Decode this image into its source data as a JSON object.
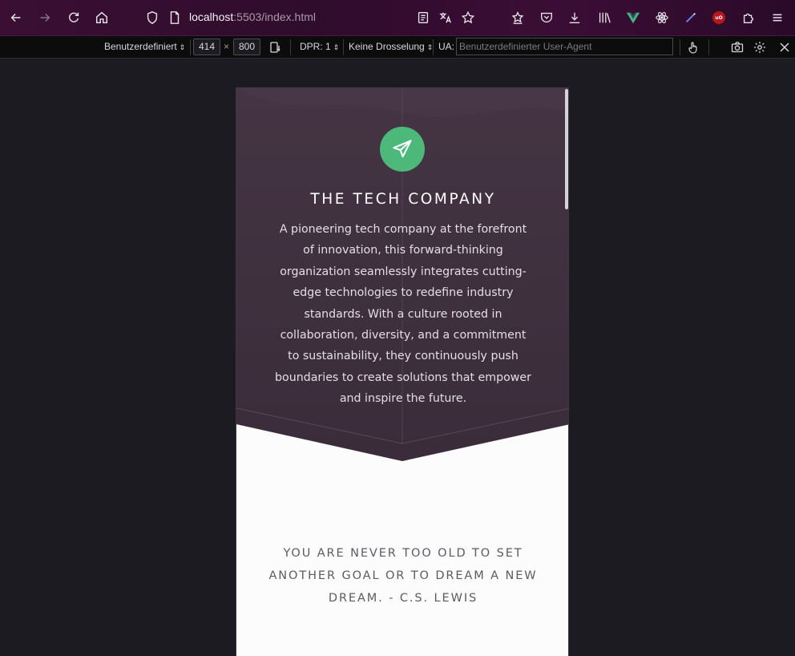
{
  "browser": {
    "url_host": "localhost",
    "url_rest": ":5503/index.html"
  },
  "rdm": {
    "device": "Benutzerdefiniert",
    "width": "414",
    "times": "×",
    "height": "800",
    "dpr": "DPR: 1",
    "throttle": "Keine Drosselung",
    "ua_label": "UA:",
    "ua_placeholder": "Benutzerdefinierter User-Agent"
  },
  "page": {
    "colors": {
      "hero_bg": "#3e2f3d",
      "accent": "#4cb87a",
      "page_bg": "#fcfcfc"
    },
    "logo_icon": "paper-plane-icon",
    "company_name": "THE TECH COMPANY",
    "company_description": "A pioneering tech company at the forefront of innovation, this forward-thinking organization seamlessly integrates cutting-edge technologies to redefine industry standards. With a culture rooted in collaboration, diversity, and a commitment to sustainability, they continuously push boundaries to create solutions that empower and inspire the future.",
    "quote": "YOU ARE NEVER TOO OLD TO SET ANOTHER GOAL OR TO DREAM A NEW DREAM. - C.S. LEWIS"
  }
}
